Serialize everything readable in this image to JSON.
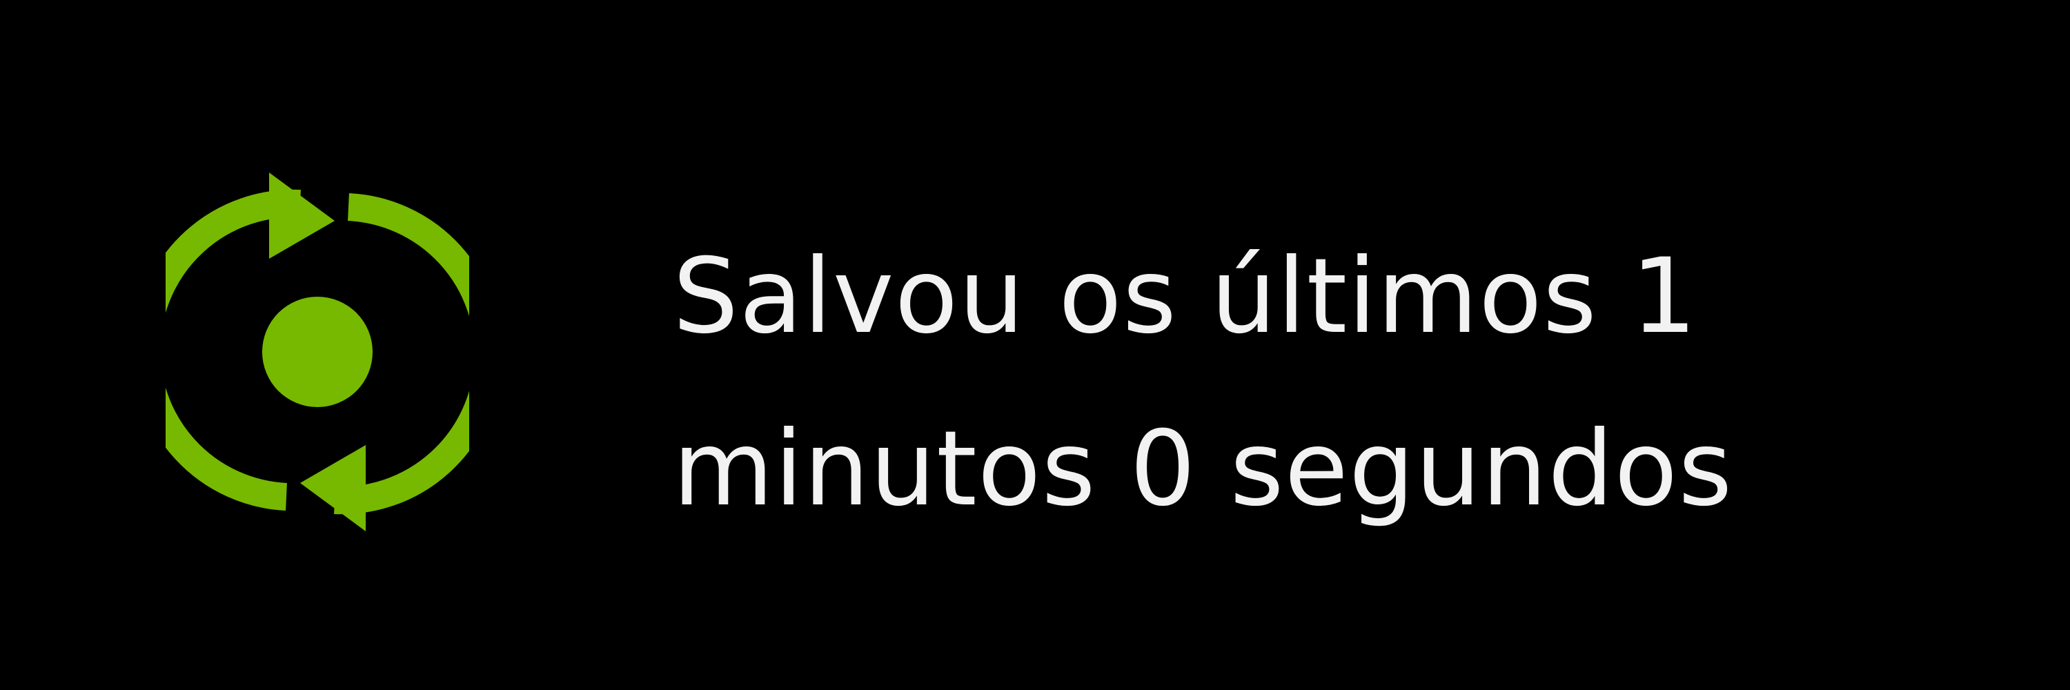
{
  "notification": {
    "icon": "replay-capture-icon",
    "accent_color": "#76b900",
    "text_color": "#f2f2f2",
    "background_color": "#000000",
    "message_line1": "Salvou os últimos 1",
    "message_line2": "minutos 0 segundos"
  }
}
